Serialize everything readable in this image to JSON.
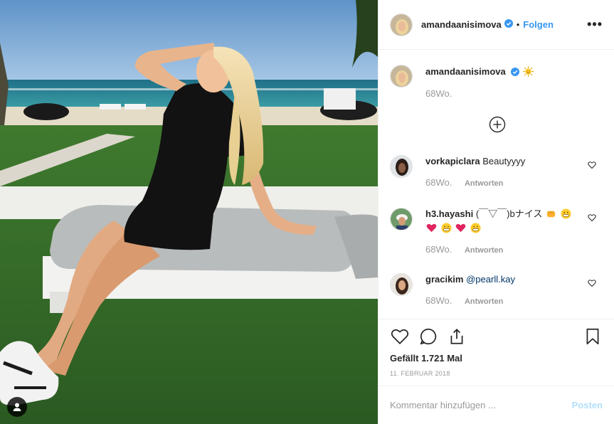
{
  "post": {
    "username": "amandaanisimova",
    "follow_label": "Folgen",
    "dot": "•",
    "more_label": "•••",
    "caption": {
      "username": "amandaanisimova",
      "emoji": "sun-face",
      "time": "68Wo."
    },
    "comments": [
      {
        "username": "vorkapiclara",
        "text": "Beautyyyy",
        "time": "68Wo.",
        "reply_label": "Antworten"
      },
      {
        "username": "h3.hayashi",
        "text": "(￣▽￣)bナイス",
        "time": "68Wo.",
        "reply_label": "Antworten"
      },
      {
        "username": "gracikim",
        "mention": "@pearll.kay",
        "time": "68Wo.",
        "reply_label": "Antworten"
      }
    ],
    "likes_text": "Gefällt 1.721 Mal",
    "date_text": "11. FEBRUAR 2018",
    "comment_placeholder": "Kommentar hinzufügen ...",
    "post_label": "Posten"
  },
  "colors": {
    "accent": "#3897f0",
    "verified": "#3897f0",
    "muted": "#999999",
    "post_disabled": "#b2dffc"
  }
}
